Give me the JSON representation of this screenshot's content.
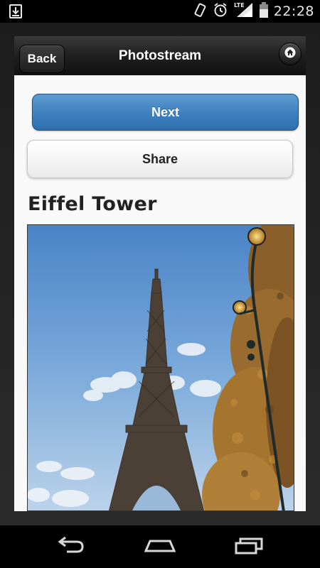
{
  "status_bar": {
    "time": "22:28",
    "network": "LTE",
    "icons": [
      "download-icon",
      "vibrate-icon",
      "alarm-icon",
      "signal-icon",
      "battery-icon"
    ]
  },
  "header": {
    "back_label": "Back",
    "title": "Photostream",
    "home_icon": "home-icon"
  },
  "actions": {
    "next_label": "Next",
    "share_label": "Share"
  },
  "photo": {
    "title": "Eiffel Tower"
  },
  "nav_bar": {
    "icons": [
      "back-nav-icon",
      "home-nav-icon",
      "recent-apps-icon"
    ]
  },
  "colors": {
    "next_button": "#3d7fbf",
    "content_bg": "#f9f9f9",
    "header_bg": "#1f1f1f"
  }
}
